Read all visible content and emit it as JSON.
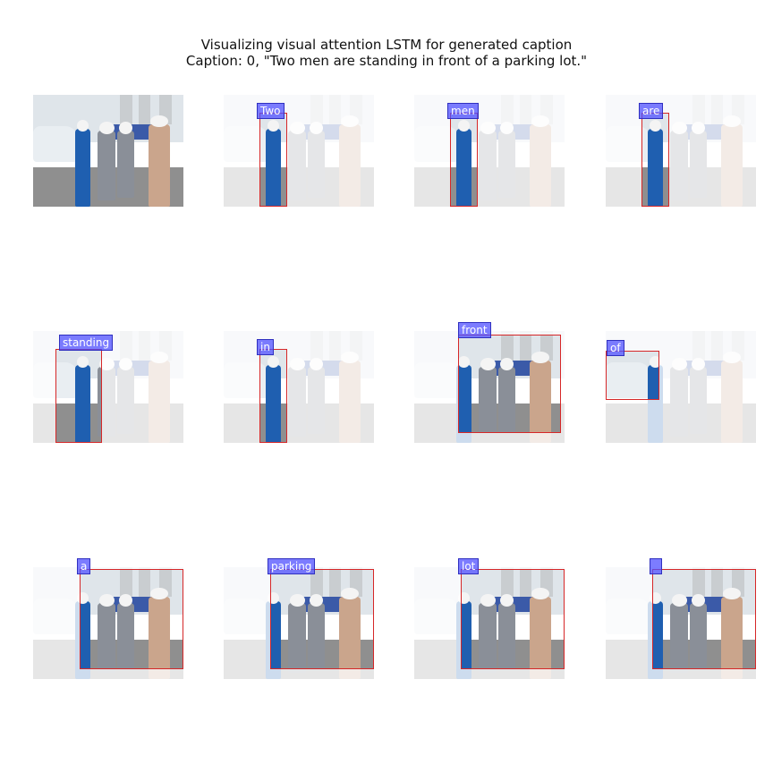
{
  "title_line1": "Visualizing visual attention LSTM for generated caption",
  "title_line2": "Caption: 0, \"Two men are standing in front of a parking lot.\"",
  "words": [
    "Two",
    "men",
    "are",
    "standing",
    "in",
    "front",
    "of",
    "a",
    "parking",
    "lot",
    ""
  ],
  "colors": {
    "box_border": "#d62728",
    "tag_background": "#6464ff",
    "person_blue": "#1f5fb0",
    "person_gray": "#8a8f98",
    "person_tan": "#caa58c"
  }
}
